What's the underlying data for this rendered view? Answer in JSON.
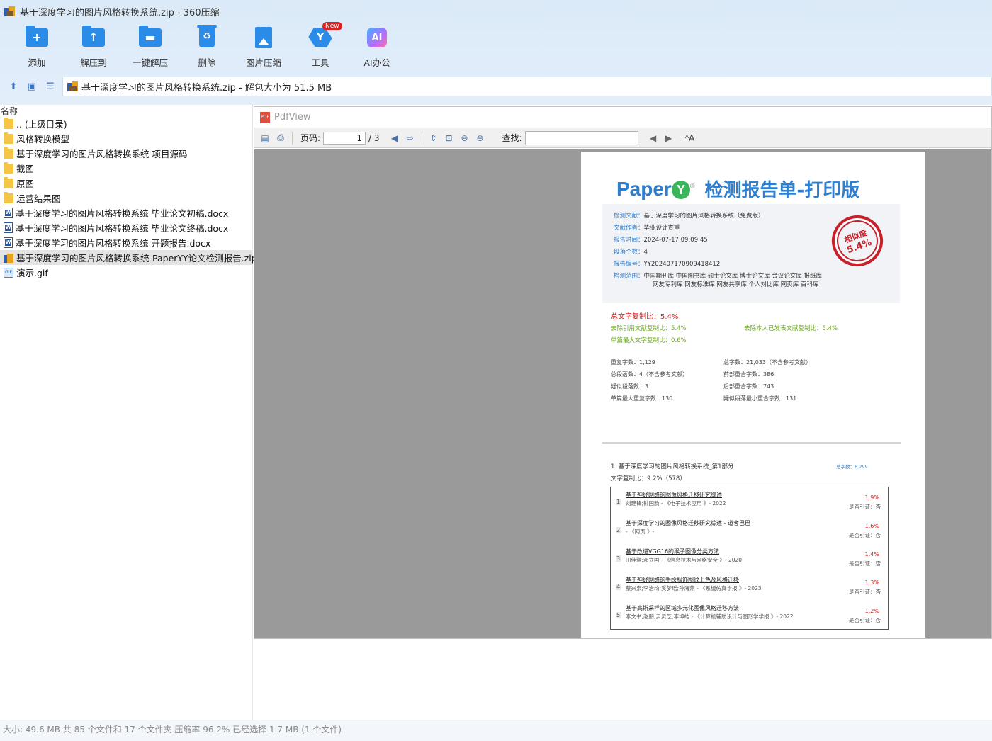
{
  "window": {
    "title": "基于深度学习的图片风格转换系统.zip - 360压缩"
  },
  "toolbar": {
    "buttons": [
      {
        "label": "添加",
        "icon": "add-folder-icon"
      },
      {
        "label": "解压到",
        "icon": "extract-to-icon"
      },
      {
        "label": "一键解压",
        "icon": "one-click-extract-icon"
      },
      {
        "label": "删除",
        "icon": "trash-icon"
      },
      {
        "label": "图片压缩",
        "icon": "image-compress-icon"
      },
      {
        "label": "工具",
        "icon": "tools-icon",
        "badge": "New"
      },
      {
        "label": "AI办公",
        "icon": "ai-icon",
        "icon_text": "AI"
      }
    ]
  },
  "address": {
    "text": "基于深度学习的图片风格转换系统.zip - 解包大小为 51.5 MB"
  },
  "list": {
    "header": "名称",
    "items": [
      {
        "name": ".. (上级目录)",
        "type": "folder"
      },
      {
        "name": "风格转换模型",
        "type": "folder"
      },
      {
        "name": "基于深度学习的图片风格转换系统 项目源码",
        "type": "folder"
      },
      {
        "name": "截图",
        "type": "folder"
      },
      {
        "name": "原图",
        "type": "folder"
      },
      {
        "name": "运营结果图",
        "type": "folder"
      },
      {
        "name": "基于深度学习的图片风格转换系统 毕业论文初稿.docx",
        "type": "docx"
      },
      {
        "name": "基于深度学习的图片风格转换系统 毕业论文终稿.docx",
        "type": "docx"
      },
      {
        "name": "基于深度学习的图片风格转换系统 开题报告.docx",
        "type": "docx"
      },
      {
        "name": "基于深度学习的图片风格转换系统-PaperYY论文检测报告.zip",
        "type": "zip",
        "selected": true
      },
      {
        "name": "演示.gif",
        "type": "gif"
      }
    ]
  },
  "viewer": {
    "title": "PdfView",
    "page_label": "页码:",
    "page_current": "1",
    "page_total": "/ 3",
    "find_label": "查找:"
  },
  "report": {
    "logo": "Paper",
    "heading": "检测报告单-打印版",
    "info": [
      {
        "k": "检测文献：",
        "v": "基于深度学习的图片风格转换系统（免费版）"
      },
      {
        "k": "文献作者：",
        "v": "毕业设计查重"
      },
      {
        "k": "报告时间：",
        "v": "2024-07-17  09:09:45"
      },
      {
        "k": "段落个数：",
        "v": "4"
      },
      {
        "k": "报告编号：",
        "v": "YY202407170909418412"
      },
      {
        "k": "检测范围：",
        "v": "中国期刊库  中国图书库  硕士论文库  博士论文库  会议论文库  报纸库"
      },
      {
        "k": "",
        "v": "网友专利库  网友标准库  网友共享库  个人对比库  网页库  百科库"
      }
    ],
    "stamp_line1": "相似度",
    "stamp_line2": "5.4%",
    "total_ratio": "总文字复制比：5.4%",
    "exclude_cite": "去除引用文献复制比：5.4%",
    "exclude_self": "去除本人已发表文献复制比：5.4%",
    "single_max": "单篇最大文字复制比：0.6%",
    "stats_left": [
      "重复字数：1,129",
      "总段落数：4（不含参考文献）",
      "疑似段落数：3",
      "单篇最大重复字数：130"
    ],
    "stats_right": [
      "总字数：21,033（不含参考文献）",
      "前部重合字数：386",
      "后部重合字数：743",
      "疑似段落最小重合字数：131"
    ],
    "section_title": "1. 基于深度学习的图片风格转换系统_第1部分",
    "section_total": "总字数：6,299",
    "section_rate": "文字复制比：9.2%（578）",
    "similar": [
      {
        "num": "1",
        "title": "基于神经网络的图像风格迁移研究综述",
        "meta": "刘建锋;钟国韵 - 《电子技术应用 》- 2022",
        "pct": "1.9%",
        "cite": "是否引证：否"
      },
      {
        "num": "2",
        "title": "基于深度学习的图像风格迁移研究综述 - 道客巴巴",
        "meta": "- 《网页 》-",
        "pct": "1.6%",
        "cite": "是否引证：否"
      },
      {
        "num": "3",
        "title": "基于改进VGG16的猴子图像分类方法",
        "meta": "田佳鹭;邓立国 - 《信息技术与网络安全 》- 2020",
        "pct": "1.4%",
        "cite": "是否引证：否"
      },
      {
        "num": "4",
        "title": "基于神经网络的手绘服饰图纹上色及风格迁移",
        "meta": "蔡兴泉;李治均;奚梦瑶;孙海燕 - 《系统仿真学报 》- 2023",
        "pct": "1.3%",
        "cite": "是否引证：否"
      },
      {
        "num": "5",
        "title": "基于高斯采样的区域多元化图像风格迁移方法",
        "meta": "李文书;赵朋;尹灵芝;李坤皓 - 《计算机辅助设计与图形学学报 》- 2022",
        "pct": "1.2%",
        "cite": "是否引证：否"
      }
    ]
  },
  "status": {
    "text": "大小: 49.6 MB 共 85 个文件和 17 个文件夹 压缩率 96.2% 已经选择 1.7 MB (1 个文件)"
  }
}
